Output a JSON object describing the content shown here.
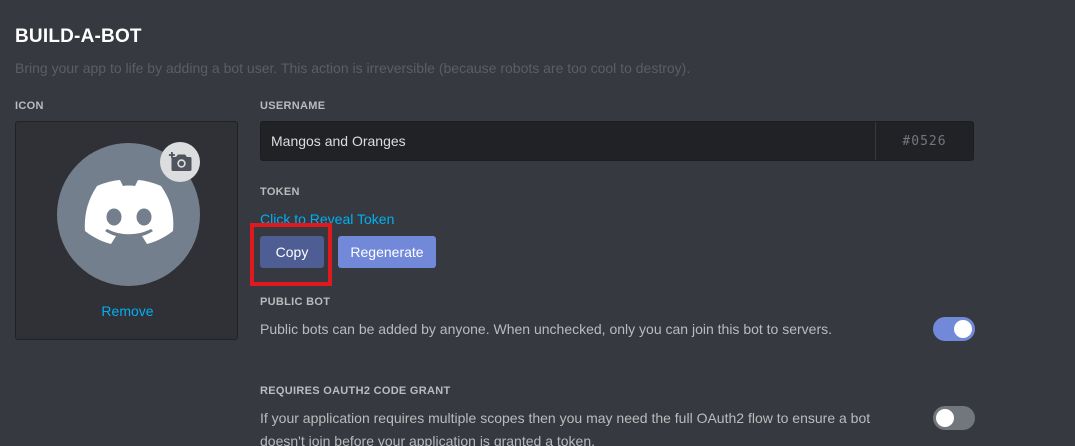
{
  "section": {
    "title": "BUILD-A-BOT",
    "subtitle": "Bring your app to life by adding a bot user. This action is irreversible (because robots are too cool to destroy)."
  },
  "icon": {
    "label": "ICON",
    "remove_label": "Remove",
    "avatar_icon": "discord-logo-icon",
    "upload_icon": "camera-plus-icon"
  },
  "username": {
    "label": "USERNAME",
    "value": "Mangos and Oranges",
    "discriminator": "#0526"
  },
  "token": {
    "label": "TOKEN",
    "reveal_label": "Click to Reveal Token",
    "copy_label": "Copy",
    "regenerate_label": "Regenerate"
  },
  "public_bot": {
    "label": "PUBLIC BOT",
    "description": "Public bots can be added by anyone. When unchecked, only you can join this bot to servers.",
    "enabled": true
  },
  "oauth2": {
    "label": "REQUIRES OAUTH2 CODE GRANT",
    "description": "If your application requires multiple scopes then you may need the full OAuth2 flow to ensure a bot doesn't join before your application is granted a token.",
    "enabled": false
  },
  "colors": {
    "background": "#36393f",
    "accent": "#7289da",
    "link": "#00b0f4",
    "highlight": "#e0191f"
  }
}
